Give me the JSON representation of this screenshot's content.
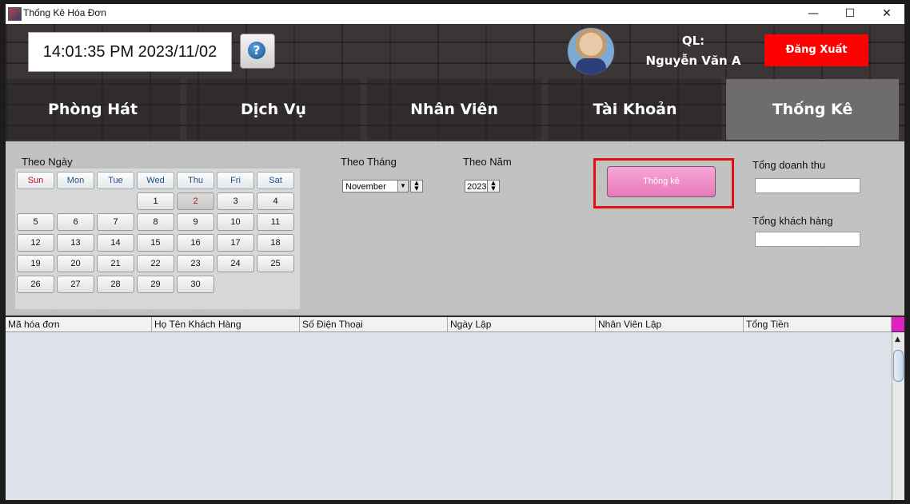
{
  "window": {
    "title": "Thống Kê Hóa Đơn",
    "controls": {
      "minimize": "—",
      "maximize": "☐",
      "close": "✕"
    }
  },
  "header": {
    "clock": "14:01:35 PM  2023/11/02",
    "role": "QL:",
    "user_name": "Nguyễn Văn A",
    "logout_label": "Đăng Xuất",
    "help_label": "?"
  },
  "tabs": [
    {
      "label": "Phòng Hát"
    },
    {
      "label": "Dịch Vụ"
    },
    {
      "label": "Nhân Viên"
    },
    {
      "label": "Tài Khoản"
    },
    {
      "label": "Thống Kê"
    }
  ],
  "filters": {
    "by_day_label": "Theo Ngày",
    "by_month_label": "Theo Tháng",
    "by_year_label": "Theo Năm",
    "month_value": "November",
    "year_value": "2023",
    "stat_button": "Thống kê",
    "total_revenue_label": "Tổng doanh thu",
    "total_revenue_value": "",
    "total_customers_label": "Tổng khách hàng",
    "total_customers_value": ""
  },
  "calendar": {
    "weekdays": [
      "Sun",
      "Mon",
      "Tue",
      "Wed",
      "Thu",
      "Fri",
      "Sat"
    ],
    "first_weekday_index": 3,
    "days_in_month": 30,
    "selected_day": 2
  },
  "table": {
    "columns": [
      "Mã hóa đơn",
      "Họ Tên Khách Hàng",
      "Số Điện Thoại",
      "Ngày Lập",
      "Nhân Viên Lập",
      "Tổng Tiền"
    ],
    "rows": []
  },
  "colors": {
    "accent": "#ff0000",
    "stat_button": "#f08ccb",
    "highlight_box": "#e01010",
    "sunday": "#c01010"
  },
  "icons": {
    "help": "help-icon",
    "avatar": "user-avatar"
  }
}
